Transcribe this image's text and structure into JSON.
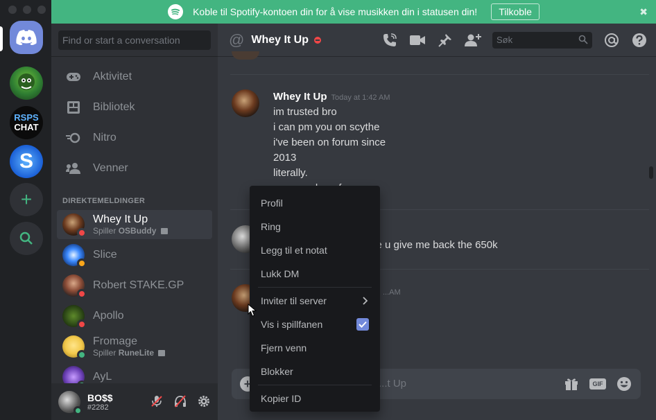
{
  "banner": {
    "text": "Koble til Spotify-kontoen din for å vise musikken din i statusen din!",
    "connect_label": "Tilkoble",
    "close_glyph": "✖"
  },
  "servers": [
    {
      "name": "home",
      "icon": "discord-logo-icon"
    },
    {
      "name": "server-1",
      "icon": "server-avatar"
    },
    {
      "name": "server-2",
      "label_line1": "RSPS",
      "label_line2": "CHAT"
    },
    {
      "name": "server-3",
      "label": "S"
    },
    {
      "name": "add-server",
      "label": "+"
    },
    {
      "name": "explore",
      "icon": "search-icon"
    }
  ],
  "sidebar": {
    "search_placeholder": "Find or start a conversation",
    "nav": [
      {
        "label": "Aktivitet",
        "icon": "gamepad-icon"
      },
      {
        "label": "Bibliotek",
        "icon": "library-icon"
      },
      {
        "label": "Nitro",
        "icon": "nitro-icon"
      },
      {
        "label": "Venner",
        "icon": "friends-icon"
      }
    ],
    "dm_header": "DIREKTEMELDINGER",
    "dms": [
      {
        "name": "Whey It Up",
        "sub_prefix": "Spiller",
        "sub_game": "OSBuddy",
        "status": "dnd",
        "active": true
      },
      {
        "name": "Slice",
        "status": "idle"
      },
      {
        "name": "Robert STAKE.GP",
        "status": "dnd"
      },
      {
        "name": "Apollo",
        "status": "dnd"
      },
      {
        "name": "Fromage",
        "sub_prefix": "Spiller",
        "sub_game": "RuneLite",
        "status": "online"
      },
      {
        "name": "AyL",
        "status": "online"
      }
    ]
  },
  "user": {
    "name": "BO$$",
    "tag": "#2282",
    "status": "online"
  },
  "chat": {
    "at_glyph": "@",
    "title": "Whey It Up",
    "search_placeholder": "Søk",
    "messages": [
      {
        "author": "Whey It Up",
        "timestamp": "Today at 1:42 AM",
        "lines": [
          "im trusted bro",
          "i can pm you on scythe",
          "i've been on forum since",
          "2013",
          "literally.",
          "...m vouch on forum"
        ]
      },
      {
        "author": "",
        "timestamp": "",
        "lines": [
          "...e u give me back the 650k"
        ]
      },
      {
        "author": "",
        "timestamp": "...AM",
        "lines": []
      }
    ],
    "composer_placeholder": "...t Up",
    "gif_label": "GIF"
  },
  "context_menu": {
    "items": [
      {
        "label": "Profil"
      },
      {
        "label": "Ring"
      },
      {
        "label": "Legg til et notat"
      },
      {
        "label": "Lukk DM"
      },
      {
        "label": "Inviter til server",
        "submenu": true
      },
      {
        "label": "Vis i spillfanen",
        "checked": true
      },
      {
        "label": "Fjern venn"
      },
      {
        "label": "Blokker"
      },
      {
        "label": "Kopier ID"
      }
    ]
  },
  "colors": {
    "accent": "#7289da",
    "spotify_green": "#43b581",
    "dnd": "#f04747",
    "idle": "#faa61a",
    "online": "#43b581"
  }
}
